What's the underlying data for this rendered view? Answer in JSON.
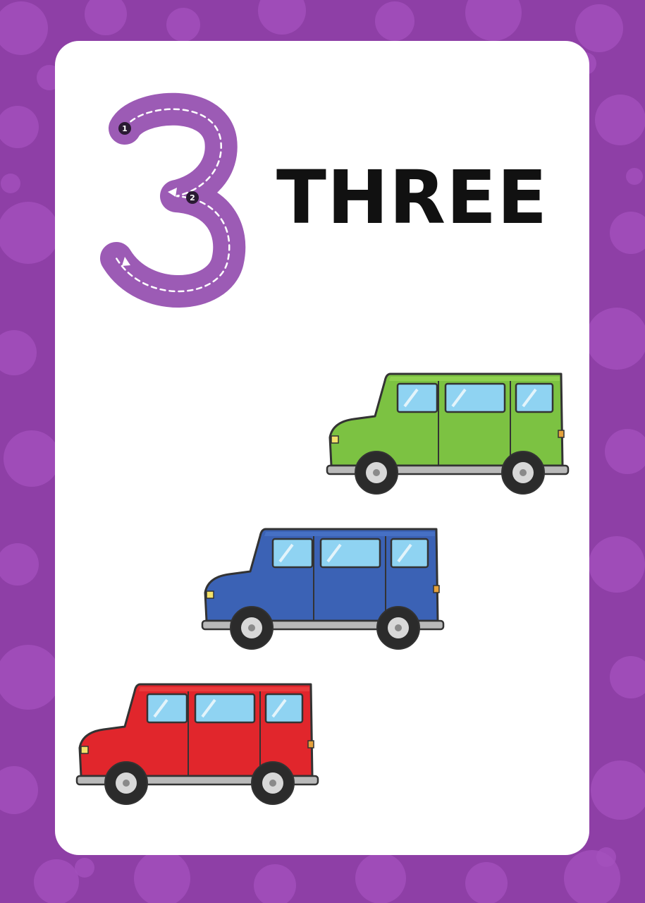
{
  "card": {
    "numeral": "3",
    "word": "THREE",
    "stroke_steps": [
      "1",
      "2"
    ]
  },
  "vehicles": [
    {
      "color": "green",
      "body": "#7cc242",
      "roof": "#8fd150"
    },
    {
      "color": "blue",
      "body": "#3b62b5",
      "roof": "#4670c4"
    },
    {
      "color": "red",
      "body": "#e1262c",
      "roof": "#ea3b3c"
    }
  ],
  "colors": {
    "background": "#8e3fa6",
    "bubble": "#a451bd",
    "card": "#ffffff",
    "numeral": "#9c5bb5",
    "word": "#111111",
    "window": "#8fd3f2",
    "tire": "#2b2b2b",
    "bumper": "#b9b9b9",
    "outline": "#333333"
  }
}
